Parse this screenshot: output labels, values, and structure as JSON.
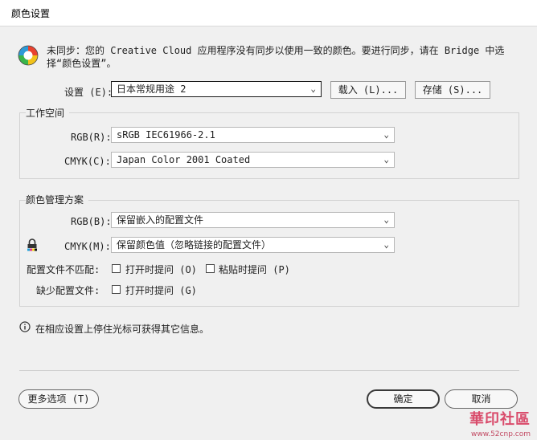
{
  "window": {
    "title": "颜色设置"
  },
  "sync_message": "未同步：您的 Creative Cloud 应用程序没有同步以使用一致的颜色。要进行同步，请在 Bridge 中选择“颜色设置”。",
  "settings": {
    "label": "设置 (E):",
    "value": "日本常规用途 2",
    "load_button": "载入 (L)...",
    "save_button": "存储 (S)..."
  },
  "working_spaces": {
    "title": "工作空间",
    "rgb_label": "RGB(R):",
    "rgb_value": "sRGB IEC61966-2.1",
    "cmyk_label": "CMYK(C):",
    "cmyk_value": "Japan Color 2001 Coated"
  },
  "color_management": {
    "title": "颜色管理方案",
    "rgb_label": "RGB(B):",
    "rgb_value": "保留嵌入的配置文件",
    "cmyk_label": "CMYK(M):",
    "cmyk_value": "保留颜色值（忽略链接的配置文件）",
    "mismatch_label": "配置文件不匹配:",
    "ask_open": "打开时提问 (O)",
    "ask_paste": "粘贴时提问 (P)",
    "missing_label": "缺少配置文件:",
    "missing_ask_open": "打开时提问 (G)"
  },
  "info_text": "在相应设置上停住光标可获得其它信息。",
  "buttons": {
    "more_options": "更多选项 (T)",
    "ok": "确定",
    "cancel": "取消"
  },
  "watermark": {
    "text": "華印社區",
    "url": "www.52cnp.com"
  }
}
